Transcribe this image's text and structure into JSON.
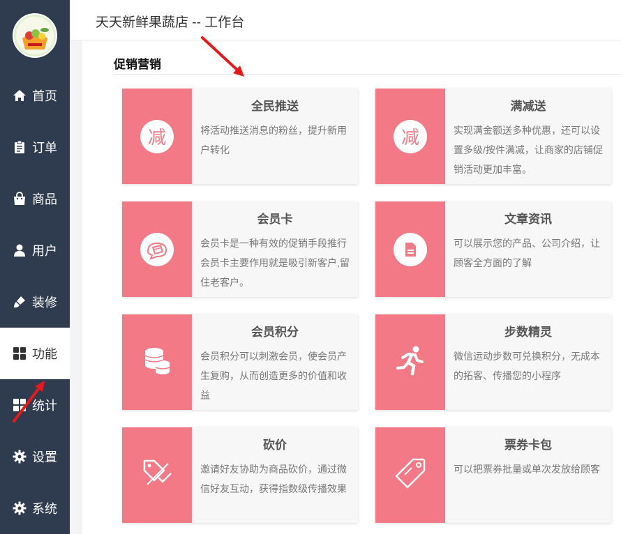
{
  "header": {
    "title": "天天新鲜果蔬店  --  工作台"
  },
  "sidebar": {
    "items": [
      {
        "label": "首页",
        "icon": "home-icon"
      },
      {
        "label": "订单",
        "icon": "clipboard-icon"
      },
      {
        "label": "商品",
        "icon": "shopping-bag-icon"
      },
      {
        "label": "用户",
        "icon": "user-icon"
      },
      {
        "label": "装修",
        "icon": "paint-brush-icon"
      },
      {
        "label": "功能",
        "icon": "grid-icon",
        "active": true
      },
      {
        "label": "统计",
        "icon": "grid-icon"
      },
      {
        "label": "设置",
        "icon": "gear-icon"
      },
      {
        "label": "系统",
        "icon": "gear-icon"
      }
    ]
  },
  "main": {
    "section_title": "促销营销",
    "cards": [
      {
        "title": "全民推送",
        "desc": "将活动推送消息的粉丝，提升新用户转化",
        "icon": "reduce-char-icon",
        "icon_text": "减"
      },
      {
        "title": "满减送",
        "desc": "实现满金额送多种优惠，还可以设置多级/按件满减，让商家的店铺促销活动更加丰富。",
        "icon": "reduce-char-icon",
        "icon_text": "减"
      },
      {
        "title": "会员卡",
        "desc": "会员卡是一种有效的促销手段推行会员卡主要作用就是吸引新客户,留住老客户。",
        "icon": "member-card-icon"
      },
      {
        "title": "文章资讯",
        "desc": "可以展示您的产品、公司介绍，让顾客全方面的了解",
        "icon": "document-icon"
      },
      {
        "title": "会员积分",
        "desc": "会员积分可以刺激会员，使会员产生复购，从而创造更多的价值和收益",
        "icon": "coins-icon"
      },
      {
        "title": "步数精灵",
        "desc": "微信运动步数可兑换积分，无成本的拓客、传播您的小程序",
        "icon": "running-icon"
      },
      {
        "title": "砍价",
        "desc": "邀请好友协助为商品砍价，通过微信好友互动，获得指数级传播效果",
        "icon": "bargain-tag-icon"
      },
      {
        "title": "票券卡包",
        "desc": "可以把票券批量或单次发放给顾客",
        "icon": "ticket-tag-icon"
      }
    ]
  },
  "colors": {
    "sidebar_bg": "#2f3b4e",
    "card_accent": "#f27985",
    "arrow": "#e8191b"
  }
}
